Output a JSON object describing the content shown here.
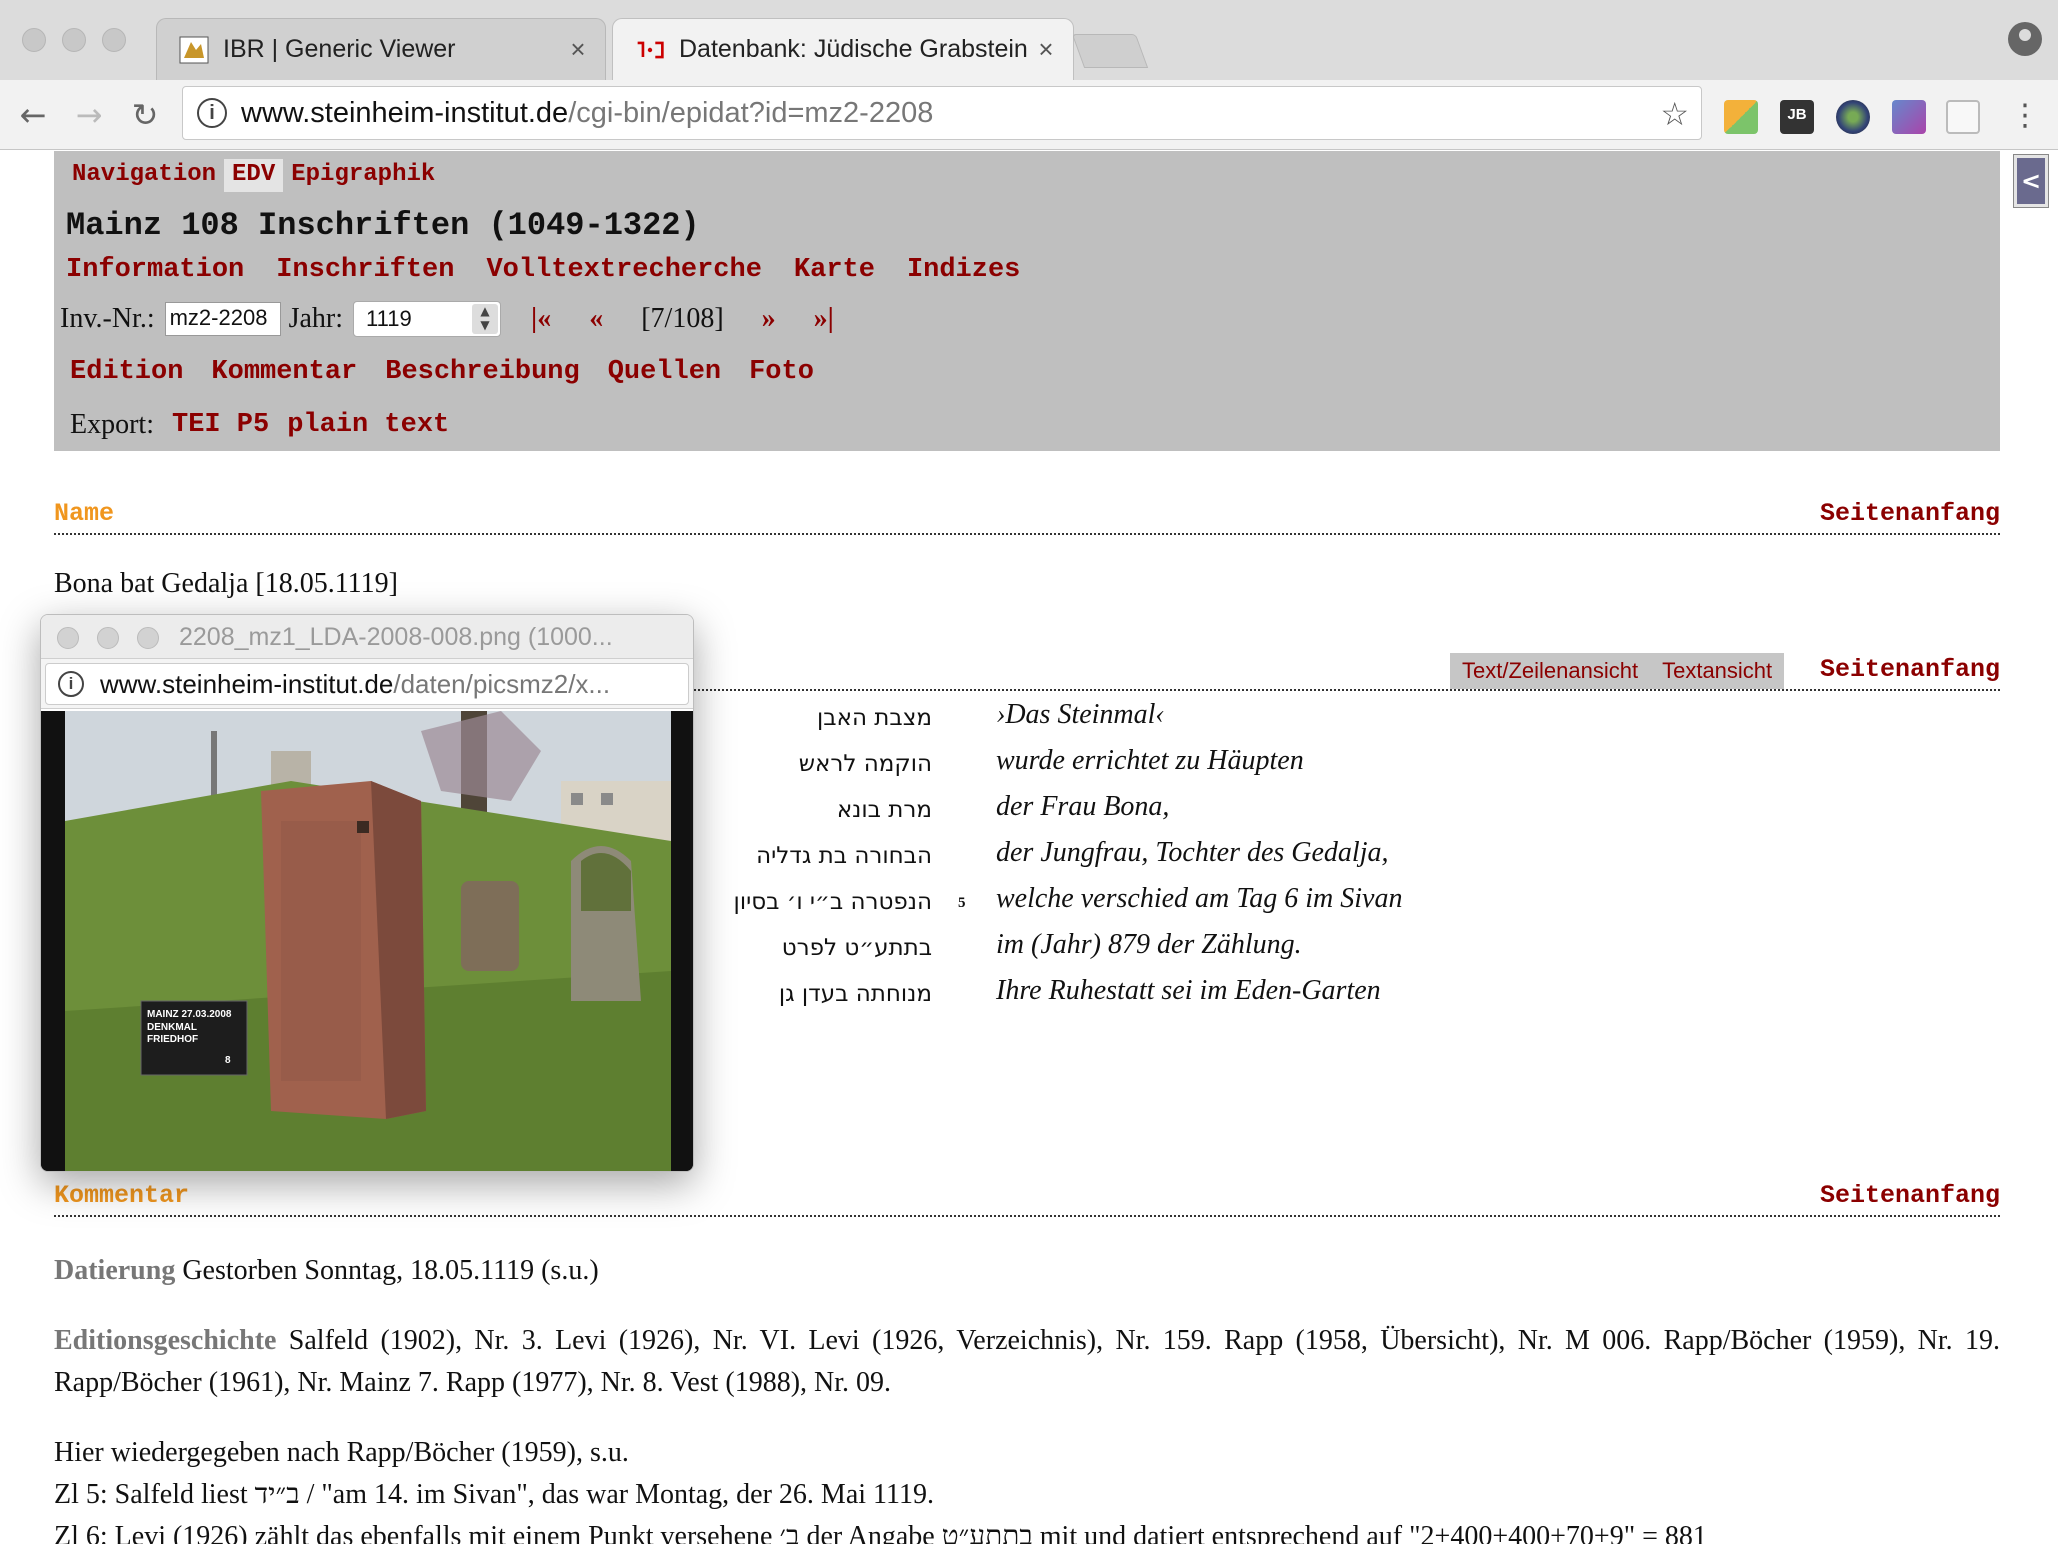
{
  "browser": {
    "tabs": [
      {
        "title": "IBR | Generic Viewer",
        "active": false
      },
      {
        "title": "Datenbank: Jüdische Grabstein",
        "active": true
      }
    ],
    "tab_close": "×",
    "url_host": "www.steinheim-institut.de",
    "url_path": "/cgi-bin/epidat?id=mz2-2208"
  },
  "nav": {
    "top_links": [
      "Navigation",
      "EDV",
      "Epigraphik"
    ],
    "db_title": "Mainz 108 Inschriften (1049-1322)",
    "main_links": [
      "Information",
      "Inschriften",
      "Volltextrecherche",
      "Karte",
      "Indizes"
    ],
    "inv_label": "Inv.-Nr.:",
    "inv_value": "mz2-2208",
    "jahr_label": "Jahr:",
    "jahr_value": "1119",
    "pager_first": "|«",
    "pager_prev": "«",
    "pager_count": "[7/108]",
    "pager_next": "»",
    "pager_last": "»|",
    "section_links": [
      "Edition",
      "Kommentar",
      "Beschreibung",
      "Quellen",
      "Foto"
    ],
    "export_label": "Export:",
    "export_links": [
      "TEI P5",
      "plain text"
    ]
  },
  "sections": {
    "name_heading": "Name",
    "top_link": "Seitenanfang",
    "name_value": "Bona bat Gedalja [18.05.1119]",
    "view_toggle": [
      "Text/Zeilenansicht",
      "Textansicht"
    ],
    "kommentar_heading": "Kommentar"
  },
  "inscription": [
    {
      "heb": "מצבת האבן",
      "num": "",
      "de": "›Das Steinmal‹"
    },
    {
      "heb": "הוקמה לראש",
      "num": "",
      "de": "wurde errichtet zu Häupten"
    },
    {
      "heb": "מרת בונא",
      "num": "",
      "de": "der Frau Bona,"
    },
    {
      "heb": "הבחורה בת גדליה",
      "num": "",
      "de": "der Jungfrau, Tochter des Gedalja,"
    },
    {
      "heb": "הנפטרה ב״י ו׳ בסיון",
      "num": "5",
      "de": "welche verschied am Tag 6 im Sivan"
    },
    {
      "heb": "בתתע״ט לפרט",
      "num": "",
      "de": "im (Jahr) 879 der Zählung."
    },
    {
      "heb": "מנוחתה בעדן גן",
      "num": "",
      "de": "Ihre Ruhestatt sei im Eden-Garten"
    }
  ],
  "kommentar": {
    "datierung_label": "Datierung",
    "datierung_text": " Gestorben Sonntag, 18.05.1119 (s.u.)",
    "edition_label": "Editionsgeschichte",
    "edition_text": " Salfeld (1902), Nr. 3. Levi (1926), Nr. VI. Levi (1926, Verzeichnis), Nr. 159. Rapp (1958, Übersicht), Nr. M 006. Rapp/Böcher (1959), Nr. 19. Rapp/Böcher (1961), Nr. Mainz 7. Rapp (1977), Nr. 8. Vest (1988), Nr. 09.",
    "line1": "Hier wiedergegeben nach Rapp/Böcher (1959), s.u.",
    "line2": "Zl 5: Salfeld liest ב״יד / \"am 14. im Sivan\", das war Montag, der 26. Mai 1119.",
    "line3": "Zl 6: Levi (1926) zählt das ebenfalls mit einem Punkt versehene ב׳ der Angabe בתתע״ט mit und datiert entsprechend auf \"2+400+400+70+9\" = 881"
  },
  "popup": {
    "title": "2208_mz1_LDA-2008-008.png (1000...",
    "url_host": "www.steinheim-institut.de",
    "url_path": "/daten/picsmz2/x...",
    "sign_text": [
      "MAINZ     27.03.2008",
      "DENKMAL",
      "FRIEDHOF",
      "8"
    ]
  }
}
